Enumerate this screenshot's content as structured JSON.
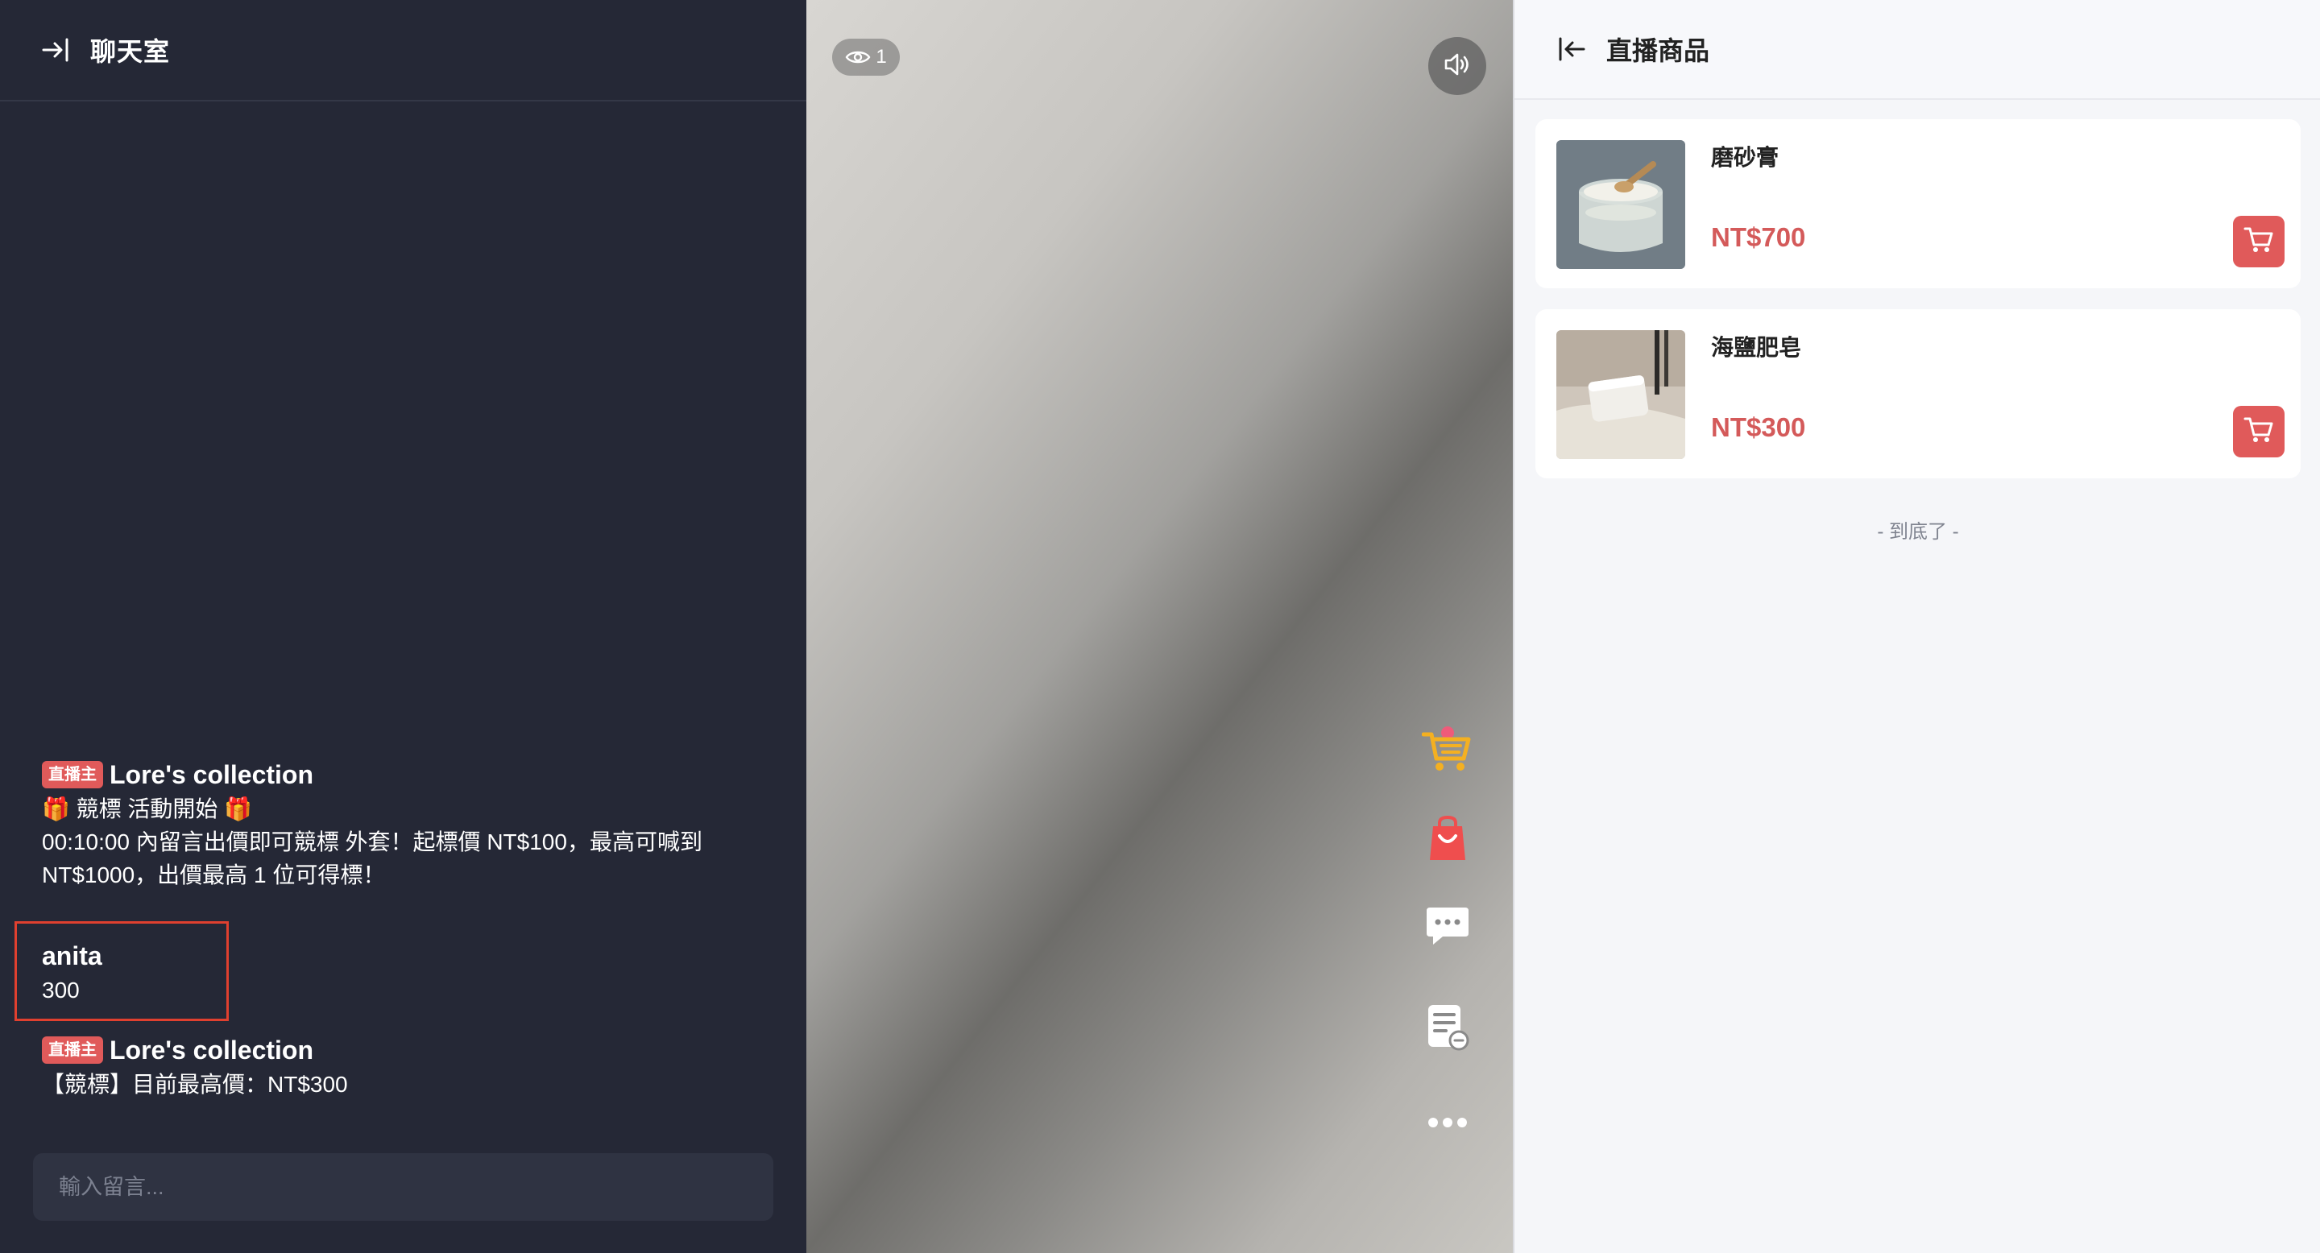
{
  "chat": {
    "title": "聊天室",
    "messages": [
      {
        "badge": "直播主",
        "name": "Lore's collection",
        "lines": [
          "🎁 競標 活動開始 🎁",
          "00:10:00 內留言出價即可競標 外套！起標價 NT$100，最高可喊到",
          "NT$1000，出價最高 1 位可得標！"
        ]
      },
      {
        "name": "anita",
        "lines": [
          "300"
        ]
      },
      {
        "badge": "直播主",
        "name": "Lore's collection",
        "lines": [
          "【競標】目前最高價：NT$300"
        ]
      }
    ],
    "input_placeholder": "輸入留言..."
  },
  "video": {
    "viewer_count": "1",
    "side_buttons": [
      "cart-icon",
      "shopping-bag-icon",
      "chat-bubble-icon",
      "order-list-icon",
      "more-icon"
    ]
  },
  "products": {
    "title": "直播商品",
    "items": [
      {
        "name": "磨砂膏",
        "price": "NT$700"
      },
      {
        "name": "海鹽肥皂",
        "price": "NT$300"
      }
    ],
    "end_text": "- 到底了 -"
  },
  "colors": {
    "chat_bg": "#252836",
    "accent_red": "#e05a5a",
    "price_red": "#d45a5a",
    "highlight_border": "#e0402f"
  }
}
